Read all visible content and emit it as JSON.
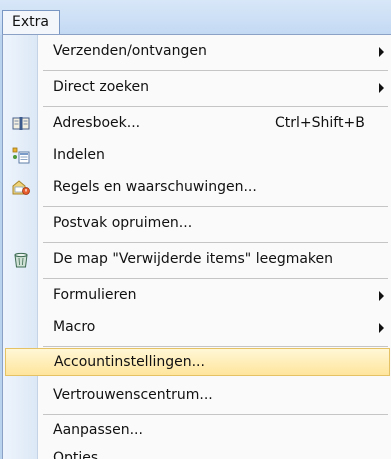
{
  "menubar": {
    "active_tab": "Extra"
  },
  "menu": {
    "items": [
      {
        "label": "Verzenden/ontvangen",
        "has_submenu": true
      },
      {
        "label": "Direct zoeken",
        "has_submenu": true
      },
      {
        "label": "Adresboek...",
        "shortcut": "Ctrl+Shift+B",
        "icon": "address-book-icon"
      },
      {
        "label": "Indelen",
        "icon": "organize-icon"
      },
      {
        "label": "Regels en waarschuwingen...",
        "icon": "rules-alerts-icon"
      },
      {
        "label": "Postvak opruimen..."
      },
      {
        "label": "De map \"Verwijderde items\" leegmaken",
        "icon": "empty-trash-icon"
      },
      {
        "label": "Formulieren",
        "has_submenu": true
      },
      {
        "label": "Macro",
        "has_submenu": true
      },
      {
        "label": "Accountinstellingen...",
        "highlighted": true
      },
      {
        "label": "Vertrouwenscentrum..."
      },
      {
        "label": "Aanpassen..."
      },
      {
        "label": "Opties..."
      }
    ]
  },
  "colors": {
    "highlight": "#ffe59c",
    "gutter": "#dce8f6",
    "background": "#c9ddf3"
  }
}
